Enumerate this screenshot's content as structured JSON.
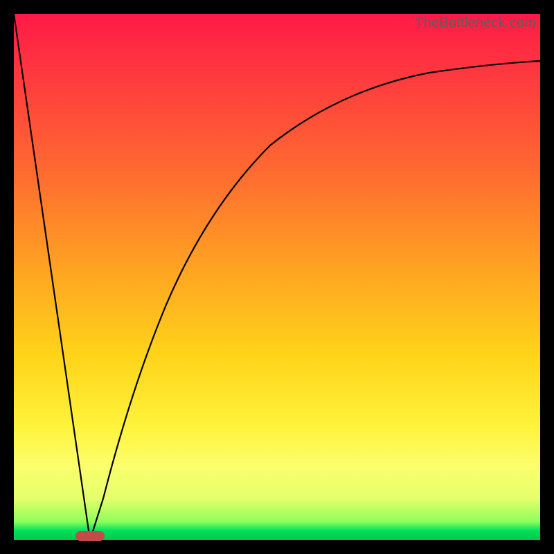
{
  "watermark": "TheBottleneck.com",
  "colors": {
    "frame": "#000000",
    "curve": "#000000",
    "marker": "#c54b4b",
    "gradient_top": "#ff1a46",
    "gradient_bottom": "#00c84b"
  },
  "chart_data": {
    "type": "line",
    "title": "",
    "xlabel": "",
    "ylabel": "",
    "xlim": [
      0,
      100
    ],
    "ylim": [
      0,
      100
    ],
    "note": "Axes unlabeled; x is a normalized component scale, y is bottleneck percentage. Values estimated from pixel positions.",
    "series": [
      {
        "name": "left-segment",
        "x": [
          0,
          14.5
        ],
        "y": [
          100,
          0
        ]
      },
      {
        "name": "right-curve",
        "x": [
          14.5,
          17,
          20,
          24,
          28,
          33,
          40,
          48,
          58,
          70,
          84,
          100
        ],
        "y": [
          0,
          8,
          18,
          30,
          41,
          52,
          63,
          72,
          79,
          84,
          87.5,
          90
        ]
      }
    ],
    "marker": {
      "name": "optimal-range",
      "x_center": 14.5,
      "y": 0,
      "width_pct": 5.5
    }
  }
}
